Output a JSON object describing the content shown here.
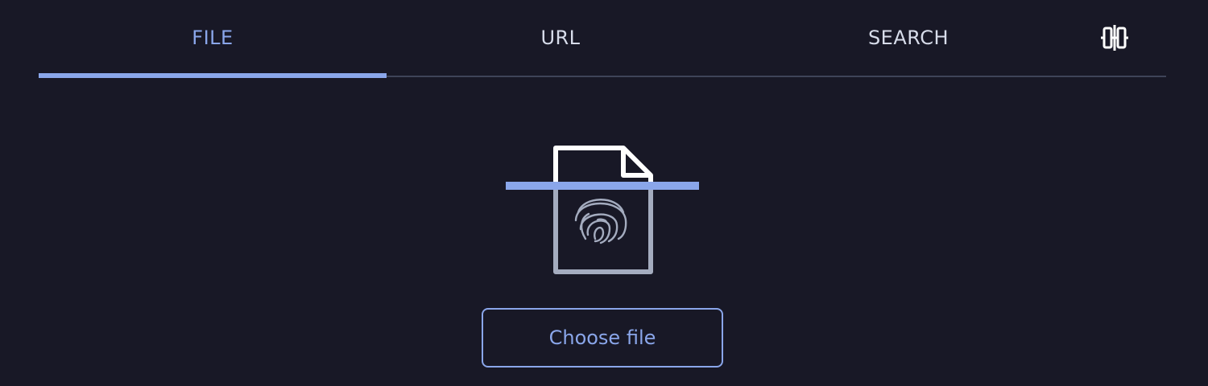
{
  "tabs": [
    {
      "label": "FILE",
      "active": true
    },
    {
      "label": "URL",
      "active": false
    },
    {
      "label": "SEARCH",
      "active": false
    }
  ],
  "tab_extra_icon": "hash-split-icon",
  "illustration": {
    "icon": "fingerprint-document-scan-icon"
  },
  "upload": {
    "button_label": "Choose file"
  },
  "colors": {
    "background": "#181826",
    "accent": "#8aa6ea",
    "tab_text": "#d7dcea",
    "divider": "#3e4458",
    "document_outline": "#a4acbf"
  }
}
